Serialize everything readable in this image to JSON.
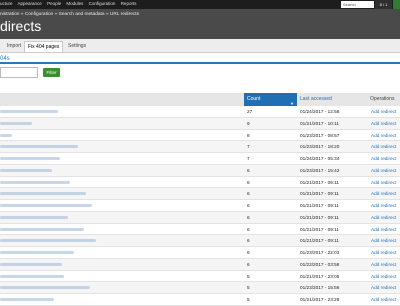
{
  "toolbar": {
    "menu": [
      "ucture",
      "Appearance",
      "People",
      "Modules",
      "Configuration",
      "Reports"
    ],
    "search_placeholder": "Search",
    "count": "8 / 1"
  },
  "header": {
    "breadcrumb": "nistration » Configuration » Search and metadata » URL redirects",
    "title": "directs"
  },
  "tabs": [
    {
      "label": "Import",
      "active": false
    },
    {
      "label": "Fix 404 pages",
      "active": true
    },
    {
      "label": "Settings",
      "active": false
    }
  ],
  "section": {
    "title": "04s"
  },
  "filter": {
    "value": "",
    "button_label": "Filter"
  },
  "table": {
    "columns": {
      "count": "Count",
      "last_accessed": "Last accessed",
      "operations": "Operations"
    },
    "rows": [
      {
        "count": "27",
        "last": "01/24/2017 - 12:58",
        "op": "Add redirect"
      },
      {
        "count": "9",
        "last": "01/21/2017 - 10:11",
        "op": "Add redirect"
      },
      {
        "count": "8",
        "last": "01/23/2017 - 08:57",
        "op": "Add redirect"
      },
      {
        "count": "7",
        "last": "01/23/2017 - 18:20",
        "op": "Add redirect"
      },
      {
        "count": "7",
        "last": "01/24/2017 - 05:34",
        "op": "Add redirect"
      },
      {
        "count": "6",
        "last": "01/23/2017 - 15:42",
        "op": "Add redirect"
      },
      {
        "count": "6",
        "last": "01/21/2017 - 09:11",
        "op": "Add redirect"
      },
      {
        "count": "6",
        "last": "01/21/2017 - 09:11",
        "op": "Add redirect"
      },
      {
        "count": "6",
        "last": "01/21/2017 - 09:11",
        "op": "Add redirect"
      },
      {
        "count": "6",
        "last": "01/21/2017 - 09:11",
        "op": "Add redirect"
      },
      {
        "count": "6",
        "last": "01/21/2017 - 09:11",
        "op": "Add redirect"
      },
      {
        "count": "6",
        "last": "01/21/2017 - 09:11",
        "op": "Add redirect"
      },
      {
        "count": "6",
        "last": "01/23/2017 - 22:03",
        "op": "Add redirect"
      },
      {
        "count": "6",
        "last": "01/22/2017 - 03:58",
        "op": "Add redirect"
      },
      {
        "count": "5",
        "last": "01/21/2017 - 23:05",
        "op": "Add redirect"
      },
      {
        "count": "5",
        "last": "01/23/2017 - 15:56",
        "op": "Add redirect"
      },
      {
        "count": "5",
        "last": "01/21/2017 - 23:28",
        "op": "Add redirect"
      }
    ]
  },
  "colors": {
    "accent": "#1f6fb5",
    "filter_button": "#3d8e33",
    "toolbar": "#1d1d1d",
    "header": "#4a4a4a"
  }
}
